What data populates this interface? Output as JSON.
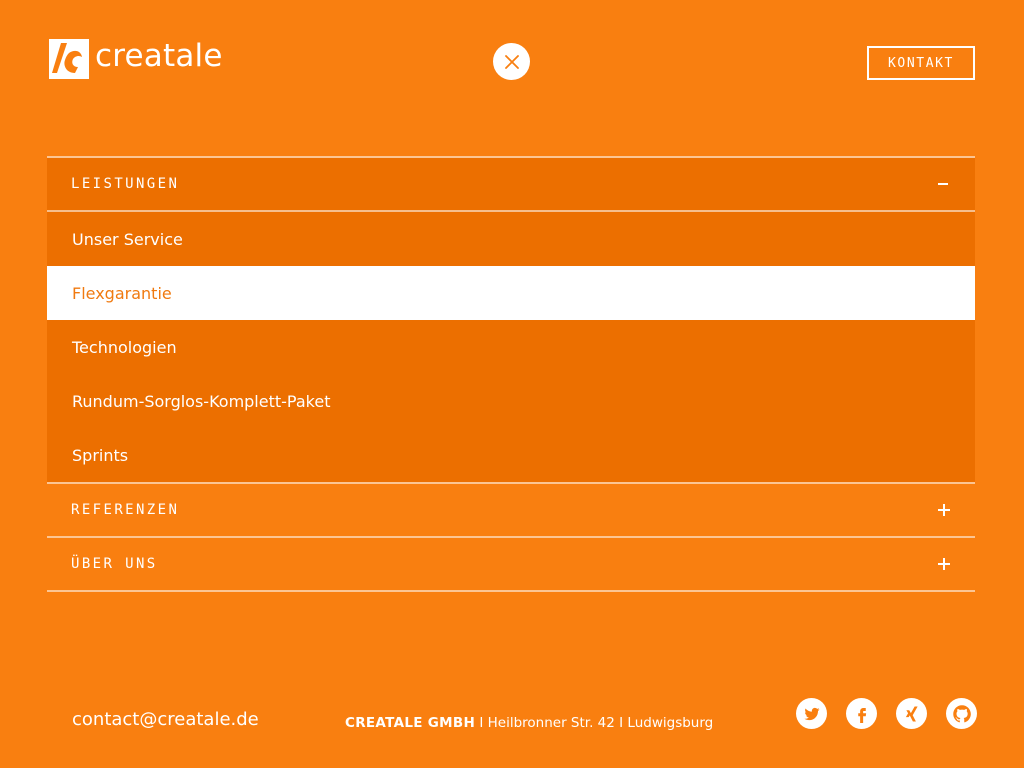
{
  "brand": {
    "name": "creatale",
    "accent": "#f97f10",
    "accent_dark": "#ec6f00"
  },
  "header": {
    "close_icon": "close-icon",
    "kontakt_label": "KONTAKT"
  },
  "menu": {
    "sections": [
      {
        "label": "LEISTUNGEN",
        "expanded": true,
        "toggle": "minus",
        "items": [
          {
            "label": "Unser Service",
            "active": false
          },
          {
            "label": "Flexgarantie",
            "active": true
          },
          {
            "label": "Technologien",
            "active": false
          },
          {
            "label": "Rundum-Sorglos-Komplett-Paket",
            "active": false
          },
          {
            "label": "Sprints",
            "active": false
          }
        ]
      },
      {
        "label": "REFERENZEN",
        "expanded": false,
        "toggle": "plus"
      },
      {
        "label": "ÜBER UNS",
        "expanded": false,
        "toggle": "plus"
      }
    ]
  },
  "footer": {
    "email": "contact@creatale.de",
    "company": "CREATALE GMBH",
    "address_rest": " I Heilbronner Str. 42 I Ludwigsburg",
    "socials": [
      "twitter-icon",
      "facebook-icon",
      "xing-icon",
      "github-icon"
    ]
  }
}
